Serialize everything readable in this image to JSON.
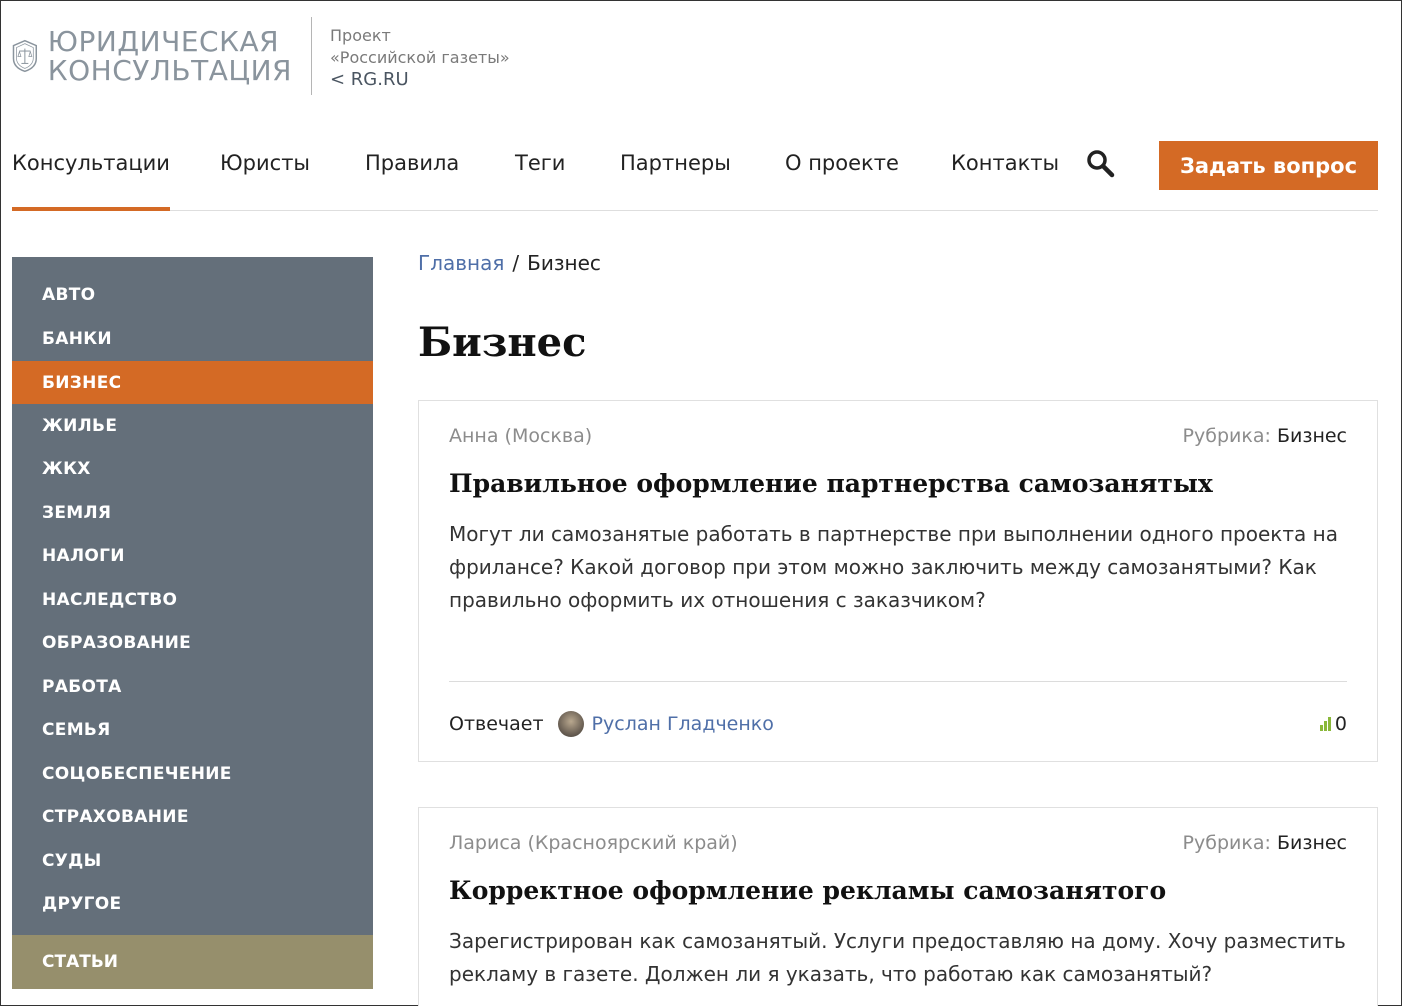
{
  "header": {
    "logo_line1": "ЮРИДИЧЕСКАЯ",
    "logo_line2": "КОНСУЛЬТАЦИЯ",
    "project_line1": "Проект",
    "project_line2": "«Российской газеты»",
    "project_link": "< RG.RU"
  },
  "nav": {
    "items": [
      "Консультации",
      "Юристы",
      "Правила",
      "Теги",
      "Партнеры",
      "О проекте",
      "Контакты"
    ],
    "active": "Консультации",
    "ask_button": "Задать вопрос"
  },
  "sidebar": {
    "items": [
      "АВТО",
      "БАНКИ",
      "БИЗНЕС",
      "ЖИЛЬЕ",
      "ЖКХ",
      "ЗЕМЛЯ",
      "НАЛОГИ",
      "НАСЛЕДСТВО",
      "ОБРАЗОВАНИЕ",
      "РАБОТА",
      "СЕМЬЯ",
      "СОЦОБЕСПЕЧЕНИЕ",
      "СТРАХОВАНИЕ",
      "СУДЫ",
      "ДРУГОЕ"
    ],
    "active": "БИЗНЕС",
    "articles": "СТАТЬИ"
  },
  "breadcrumb": {
    "home": "Главная",
    "separator": "/",
    "current": "Бизнес"
  },
  "page_title": "Бизнес",
  "questions": [
    {
      "author": "Анна (Москва)",
      "rubric_label": "Рубрика:",
      "rubric": "Бизнес",
      "title": "Правильное оформление партнерства самозанятых",
      "text": "Могут ли самозанятые работать в партнерстве при выполнении одного проекта на фрилансе? Какой договор при этом можно заключить между самозанятыми? Как правильно оформить их отношения с заказчиком?",
      "answers_label": "Отвечает",
      "expert": "Руслан Гладченко",
      "rating": "0"
    },
    {
      "author": "Лариса (Красноярский край)",
      "rubric_label": "Рубрика:",
      "rubric": "Бизнес",
      "title": "Корректное оформление рекламы самозанятого",
      "text": "Зарегистрирован как самозанятый. Услуги предоставляю на дому. Хочу разместить рекламу в газете. Должен ли я указать, что работаю как самозанятый?"
    }
  ],
  "colors": {
    "accent": "#d46a25",
    "sidebar_bg": "#646f7a",
    "articles_bg": "#968f6c",
    "link": "#4f6fa8"
  }
}
